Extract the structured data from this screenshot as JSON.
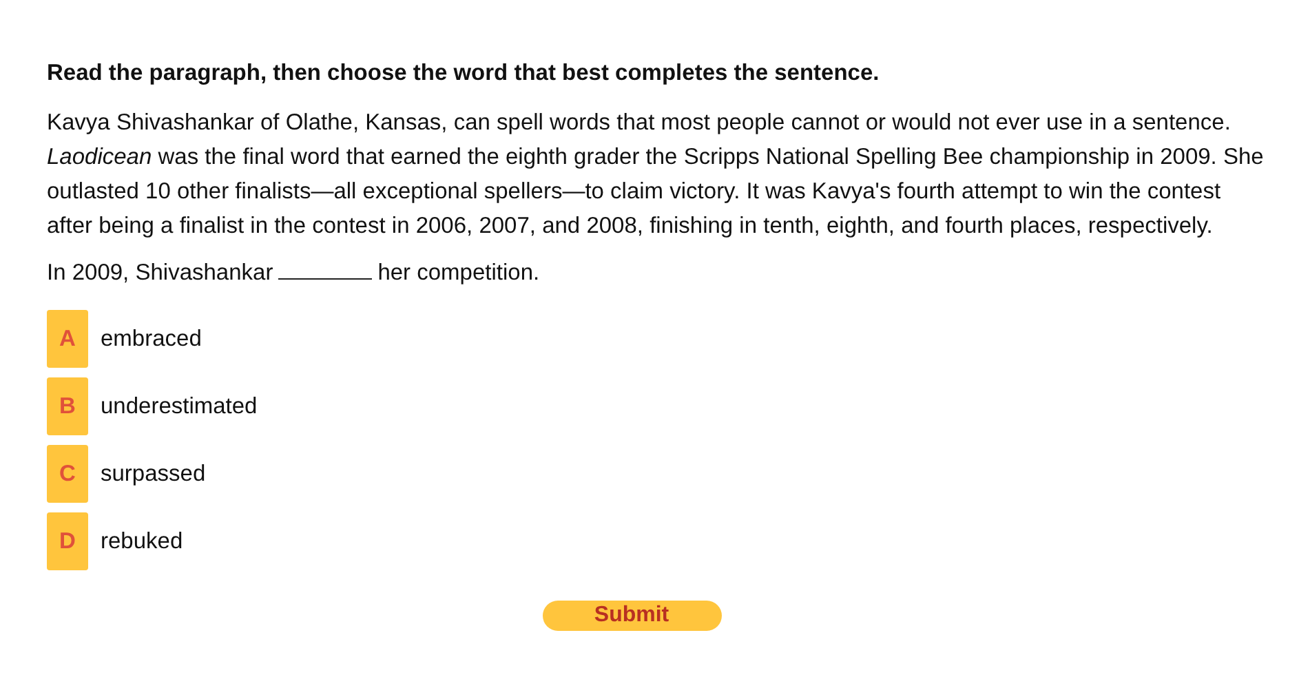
{
  "instruction": "Read the paragraph, then choose the word that best completes the sentence.",
  "passage": "Kavya Shivashankar of Olathe, Kansas, can spell words that most people cannot or would not ever use in a sentence. *Laodicean* was the final word that earned the eighth grader the Scripps National Spelling Bee championship in 2009. She outlasted 10 other finalists—all exceptional spellers—to claim victory. It was Kavya's fourth attempt to win the contest after being a finalist in the contest in 2006, 2007, and 2008, finishing in tenth, eighth, and fourth places, respectively.",
  "prompt": {
    "before": "In 2009, Shivashankar",
    "after": "her competition."
  },
  "options": [
    {
      "letter": "A",
      "text": "embraced",
      "selected": false
    },
    {
      "letter": "B",
      "text": "underestimated",
      "selected": false
    },
    {
      "letter": "C",
      "text": "surpassed",
      "selected": false
    },
    {
      "letter": "D",
      "text": "rebuked",
      "selected": false
    }
  ],
  "submit": {
    "label": "Submit"
  }
}
